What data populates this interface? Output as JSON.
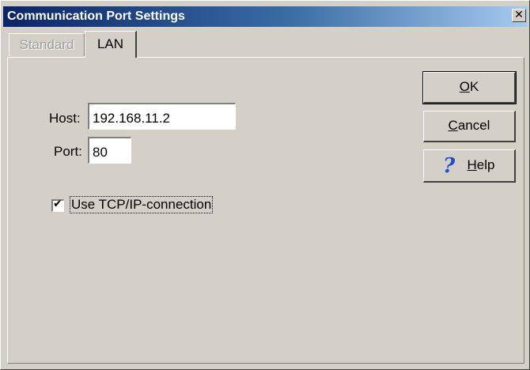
{
  "window": {
    "title": "Communication Port Settings",
    "close_glyph": "✕"
  },
  "tabs": [
    {
      "label": "Standard",
      "state": "disabled"
    },
    {
      "label": "LAN",
      "state": "selected"
    }
  ],
  "form": {
    "host_label": "Host:",
    "host_value": "192.168.11.2",
    "port_label": "Port:",
    "port_value": "80",
    "tcp_checkbox": {
      "label": "Use TCP/IP-connection",
      "checked": true,
      "check_glyph": "✔"
    }
  },
  "buttons": {
    "ok": {
      "label_underlined": "O",
      "label_rest": "K"
    },
    "cancel": {
      "label_underlined": "C",
      "label_rest": "ancel"
    },
    "help": {
      "label_underlined": "H",
      "label_rest": "elp",
      "icon": "question-mark-icon",
      "icon_glyph": "?"
    }
  },
  "colors": {
    "titlebar_start": "#0a246a",
    "titlebar_end": "#a6caf0",
    "face": "#d4d0c8",
    "help_icon": "#1f4fd0"
  }
}
